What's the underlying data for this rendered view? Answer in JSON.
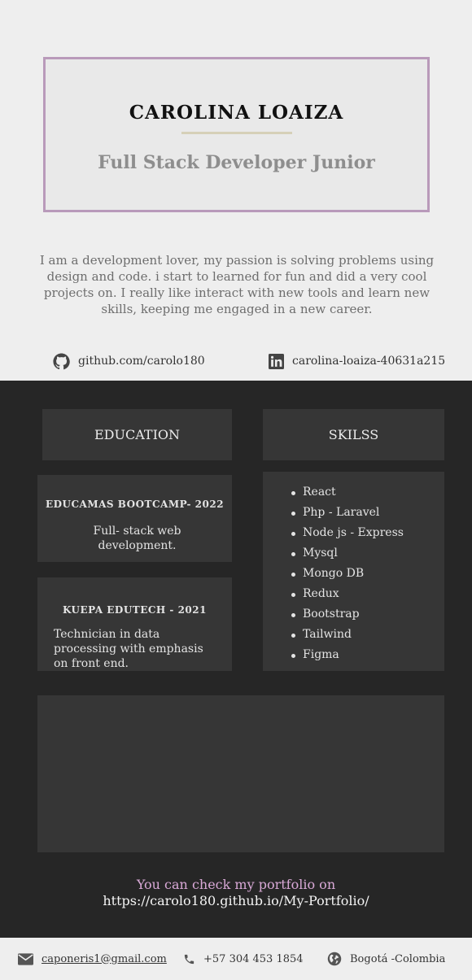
{
  "header": {
    "name": "CAROLINA LOAIZA",
    "role": "Full  Stack Developer Junior"
  },
  "bio": "I am a development lover,  my passion is solving problems using design and code.  i start to learned for fun and did a very cool projects on. I really like interact with new tools and learn new skills, keeping me engaged in a new career.",
  "links": {
    "github": "github.com/carolo180",
    "linkedin": "carolina-loaiza-40631a215"
  },
  "education": {
    "heading": "EDUCATION",
    "items": [
      {
        "title": "EDUCAMAS BOOTCAMP- 2022",
        "description": "Full- stack web development."
      },
      {
        "title": "KUEPA EDUTECH - 2021",
        "description": "Technician in data processing with emphasis on front end."
      }
    ]
  },
  "skills": {
    "heading": "SKILSS",
    "items": [
      "React",
      "Php - Laravel",
      "Node js - Express",
      "Mysql",
      "Mongo DB",
      "Redux",
      "Bootstrap",
      "Tailwind",
      "Figma"
    ]
  },
  "portfolio": {
    "intro": "You can check my portfolio on",
    "url": "https://carolo180.github.io/My-Portfolio/"
  },
  "footer": {
    "email": "caponeris1@gmail.com",
    "phone": "+57 304 453 1854",
    "location": "Bogotá -Colombia"
  },
  "colors": {
    "frame_border": "#b99aba",
    "dark_bg": "#262626",
    "card_bg": "#363636",
    "accent_pink": "#d9a9d7",
    "light_bg": "#eeeeee"
  },
  "icons": [
    "github-icon",
    "linkedin-icon",
    "envelope-icon",
    "phone-icon",
    "globe-icon"
  ]
}
